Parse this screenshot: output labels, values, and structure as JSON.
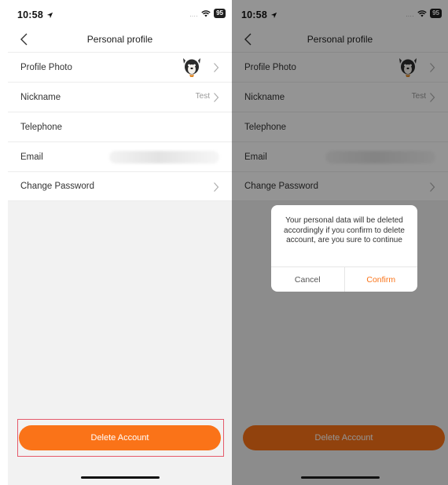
{
  "status_bar": {
    "time": "10:58",
    "battery": "95"
  },
  "nav": {
    "title": "Personal profile"
  },
  "profile_rows": [
    {
      "label": "Profile Photo"
    },
    {
      "label": "Nickname",
      "value": "Test"
    },
    {
      "label": "Telephone"
    },
    {
      "label": "Email"
    },
    {
      "label": "Change Password"
    }
  ],
  "delete_account": {
    "label": "Delete Account"
  },
  "dialog": {
    "message": "Your personal data will be deleted accordingly if you confirm to delete account, are you sure to continue",
    "cancel_label": "Cancel",
    "confirm_label": "Confirm"
  },
  "colors": {
    "accent": "#fa7318",
    "highlight": "#e55a6b",
    "overlay": "rgba(0,0,0,0.42)"
  },
  "icons": [
    "location-arrow-icon",
    "wifi-icon",
    "battery-icon",
    "back-chevron-icon",
    "chevron-right-icon",
    "dog-avatar"
  ]
}
